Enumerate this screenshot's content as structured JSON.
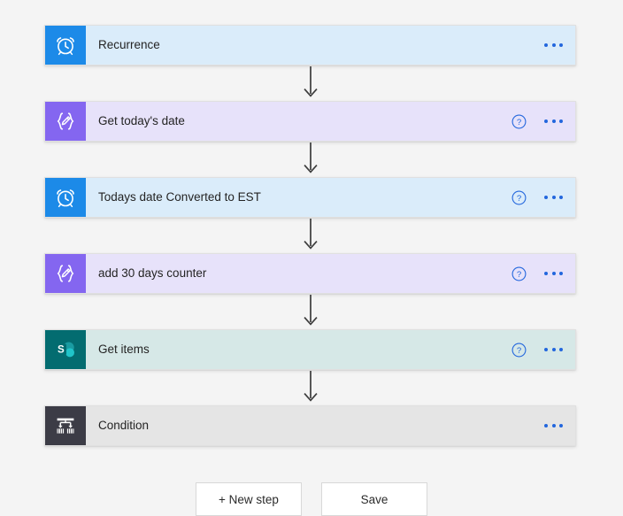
{
  "theme": {
    "canvas_bg": "#f4f4f4",
    "blue_icon": "#1c8ae8",
    "blue_body": "#daecfa",
    "purple_icon": "#8466f0",
    "purple_body": "#e7e2fa",
    "teal_icon": "#036c70",
    "teal_body": "#d6e8e7",
    "gray_icon": "#3c3c46",
    "gray_body": "#e5e5e5",
    "accent_dots": "#2266dd",
    "help_blue": "#2266dd",
    "arrow": "#3b3b3b"
  },
  "flow": {
    "steps": [
      {
        "title": "Recurrence",
        "icon": "alarm-clock-icon",
        "variant": "blue",
        "has_help": false,
        "has_menu": true
      },
      {
        "title": "Get today's date",
        "icon": "compose-braces-pencil-icon",
        "variant": "purple",
        "has_help": true,
        "has_menu": true
      },
      {
        "title": "Todays date Converted to EST",
        "icon": "alarm-clock-icon",
        "variant": "blue",
        "has_help": true,
        "has_menu": true
      },
      {
        "title": "add 30 days counter",
        "icon": "compose-braces-pencil-icon",
        "variant": "purple",
        "has_help": true,
        "has_menu": true
      },
      {
        "title": "Get items",
        "icon": "sharepoint-icon",
        "variant": "teal",
        "has_help": true,
        "has_menu": true
      },
      {
        "title": "Condition",
        "icon": "condition-branch-icon",
        "variant": "gray",
        "has_help": false,
        "has_menu": true
      }
    ],
    "connector_count": 5,
    "connector_icon": "down-arrow-icon"
  },
  "footer": {
    "new_step_label": "+ New step",
    "save_label": "Save"
  }
}
